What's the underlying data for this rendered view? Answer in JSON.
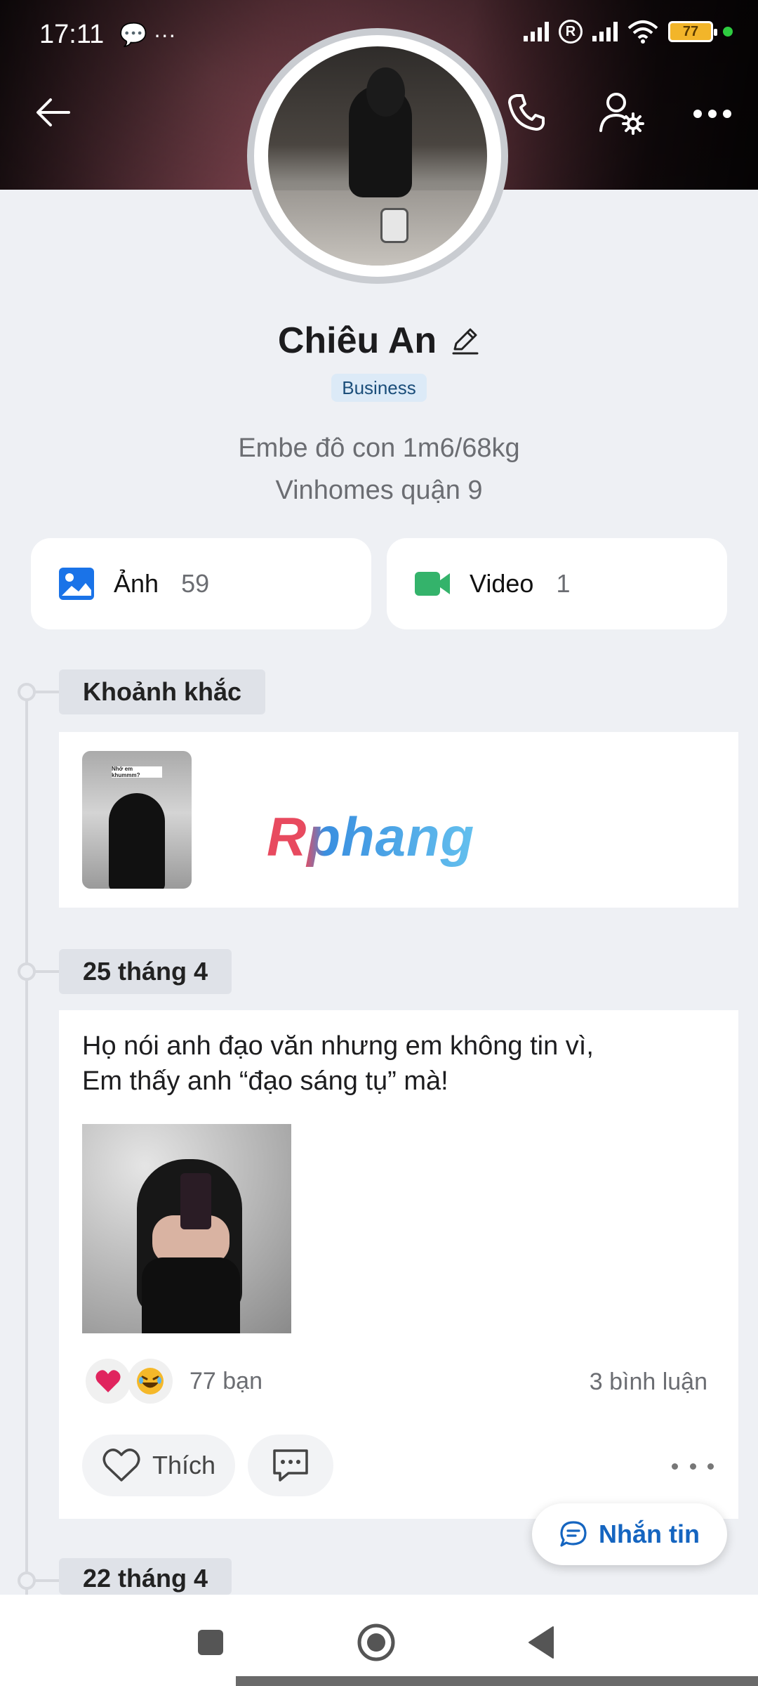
{
  "status_bar": {
    "time": "17:11",
    "left_icons": "💬 ···",
    "battery": "77"
  },
  "profile": {
    "name": "Chiêu An",
    "badge": "Business",
    "bio_lines": [
      "Embe đô con 1m6/68kg",
      "Vinhomes quận 9"
    ]
  },
  "media": {
    "photos_label": "Ảnh",
    "photos_count": "59",
    "videos_label": "Video",
    "videos_count": "1"
  },
  "moments": {
    "section_label": "Khoảnh khắc",
    "thumb_caption": "Nhớ em khummm?",
    "watermark": "Rphang"
  },
  "post": {
    "date_label": "25 tháng 4",
    "text_line1": "Họ nói anh đạo văn nhưng em không tin vì,",
    "text_line2": "Em thấy anh “đạo sáng tụ” mà!",
    "reactions_count": "77 bạn",
    "comments_count": "3 bình luận",
    "like_label": "Thích"
  },
  "next_section": {
    "date_label": "22 tháng 4"
  },
  "fab": {
    "message_label": "Nhắn tin"
  },
  "colors": {
    "accent_blue": "#1565c0",
    "photo_icon": "#1a73e8",
    "video_icon": "#34b36b",
    "heart": "#e0245e"
  }
}
